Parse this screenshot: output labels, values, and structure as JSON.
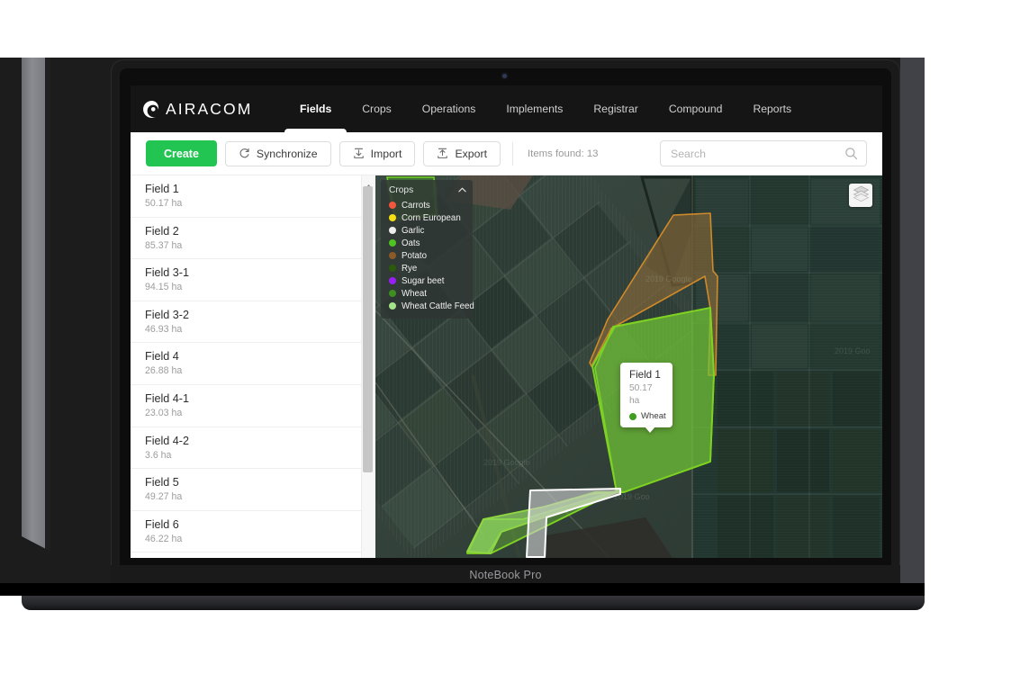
{
  "device": {
    "model_label": "NoteBook Pro"
  },
  "app": {
    "brand": "AIRACOM",
    "nav": [
      {
        "label": "Fields",
        "active": true
      },
      {
        "label": "Crops",
        "active": false
      },
      {
        "label": "Operations",
        "active": false
      },
      {
        "label": "Implements",
        "active": false
      },
      {
        "label": "Registrar",
        "active": false
      },
      {
        "label": "Compound",
        "active": false
      },
      {
        "label": "Reports",
        "active": false
      }
    ],
    "toolbar": {
      "create_label": "Create",
      "synchronize_label": "Synchronize",
      "import_label": "Import",
      "export_label": "Export",
      "items_found": "Items found: 13",
      "search_placeholder": "Search",
      "search_value": ""
    },
    "fields": [
      {
        "name": "Field 1",
        "area": "50.17 ha"
      },
      {
        "name": "Field 2",
        "area": "85.37 ha"
      },
      {
        "name": "Field 3-1",
        "area": "94.15 ha"
      },
      {
        "name": "Field 3-2",
        "area": "46.93 ha"
      },
      {
        "name": "Field 4",
        "area": "26.88 ha"
      },
      {
        "name": "Field 4-1",
        "area": "23.03 ha"
      },
      {
        "name": "Field 4-2",
        "area": "3.6 ha"
      },
      {
        "name": "Field 5",
        "area": "49.27 ha"
      },
      {
        "name": "Field 6",
        "area": "46.22 ha"
      }
    ],
    "map": {
      "legend_title": "Crops",
      "legend": [
        {
          "label": "Carrots",
          "color": "#f2573d"
        },
        {
          "label": "Corn European",
          "color": "#f5e014"
        },
        {
          "label": "Garlic",
          "color": "#ededed"
        },
        {
          "label": "Oats",
          "color": "#4fc322"
        },
        {
          "label": "Potato",
          "color": "#8b5a28"
        },
        {
          "label": "Rye",
          "color": "#2b5a0c"
        },
        {
          "label": "Sugar beet",
          "color": "#9a1ff5"
        },
        {
          "label": "Wheat",
          "color": "#3f8f20"
        },
        {
          "label": "Wheat Cattle Feed",
          "color": "#a5e58a"
        }
      ],
      "tooltip": {
        "title": "Field 1",
        "area": "50.17 ha",
        "crop": "Wheat",
        "crop_color": "#3f9d21"
      },
      "layers_icon": "layers-stack-icon",
      "attribution": "2019 Google"
    },
    "colors": {
      "accent_green": "#23c552",
      "nav_bg": "#151515",
      "field_outline_green": "#7ed321",
      "field_outline_orange": "#d08a2a",
      "field_outline_white": "#ffffff"
    }
  }
}
